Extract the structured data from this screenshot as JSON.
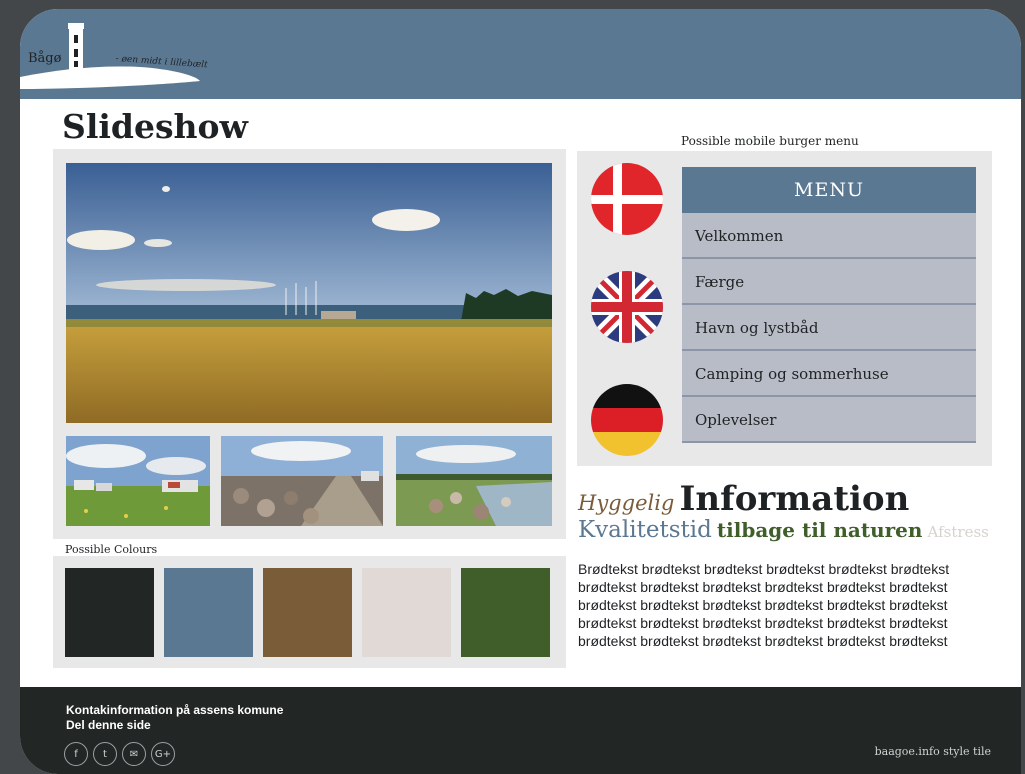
{
  "header": {
    "logo_name": "Bågø",
    "logo_tagline": "- øen midt i lillebælt"
  },
  "slideshow": {
    "title": "Slideshow"
  },
  "colours": {
    "label": "Possible Colours",
    "swatches": [
      "#222624",
      "#5b7892",
      "#7a5c39",
      "#e0d9d5",
      "#3f5e2a"
    ]
  },
  "burger": {
    "label": "Possible mobile burger menu",
    "flags": [
      "danish-flag-icon",
      "uk-flag-icon",
      "german-flag-icon"
    ],
    "menu_title": "MENU",
    "items": [
      "Velkommen",
      "Færge",
      "Havn og lystbåd",
      "Camping og sommerhuse",
      "Oplevelser"
    ]
  },
  "tagline": {
    "word1": "Hyggelig",
    "word2": "Information",
    "word3": "Kvalitetstid",
    "word4": "tilbage til naturen",
    "word5": "Afstress"
  },
  "body": {
    "text": "Brødtekst brødtekst brødtekst brødtekst brødtekst brødtekst brødtekst brødtekst brødtekst brødtekst brødtekst brødtekst brødtekst brødtekst brødtekst brødtekst brødtekst brødtekst brødtekst brødtekst brødtekst brødtekst brødtekst brødtekst brødtekst brødtekst brødtekst brødtekst brødtekst brødtekst"
  },
  "footer": {
    "line1": "Kontakinformation på assens komune",
    "line2": "Del denne side",
    "social": [
      {
        "name": "facebook-icon",
        "glyph": "f"
      },
      {
        "name": "twitter-icon",
        "glyph": "t"
      },
      {
        "name": "email-icon",
        "glyph": "✉"
      },
      {
        "name": "google-plus-icon",
        "glyph": "G+"
      }
    ],
    "credit": "baagoe.info style tile"
  }
}
